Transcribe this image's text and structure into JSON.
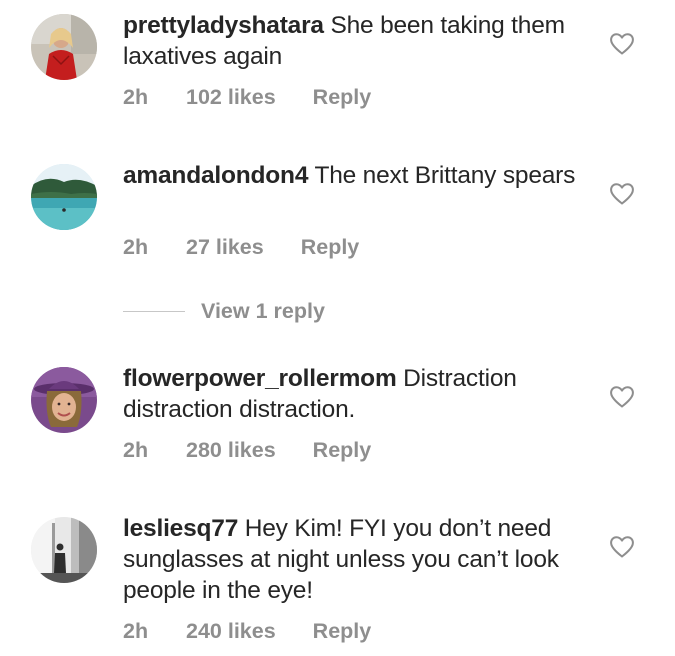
{
  "comments": [
    {
      "username": "prettyladyshatara",
      "text": "She been taking them laxatives again",
      "time": "2h",
      "likes": "102 likes",
      "reply": "Reply"
    },
    {
      "username": "amandalondon4",
      "text": "The next Brittany spears",
      "time": "2h",
      "likes": "27 likes",
      "reply": "Reply"
    },
    {
      "username": "flowerpower_rollermom",
      "text": "Distraction distraction distraction.",
      "time": "2h",
      "likes": "280 likes",
      "reply": "Reply"
    },
    {
      "username": "lesliesq77",
      "text": "Hey Kim! FYI you don’t need sunglasses at night unless you can’t look people in the eye!",
      "time": "2h",
      "likes": "240 likes",
      "reply": "Reply"
    }
  ],
  "view_replies": "View 1 reply",
  "icons": {
    "like": "heart-outline-icon"
  },
  "colors": {
    "text": "#262626",
    "meta": "#8e8e8e",
    "divider": "#c7c7c7"
  }
}
